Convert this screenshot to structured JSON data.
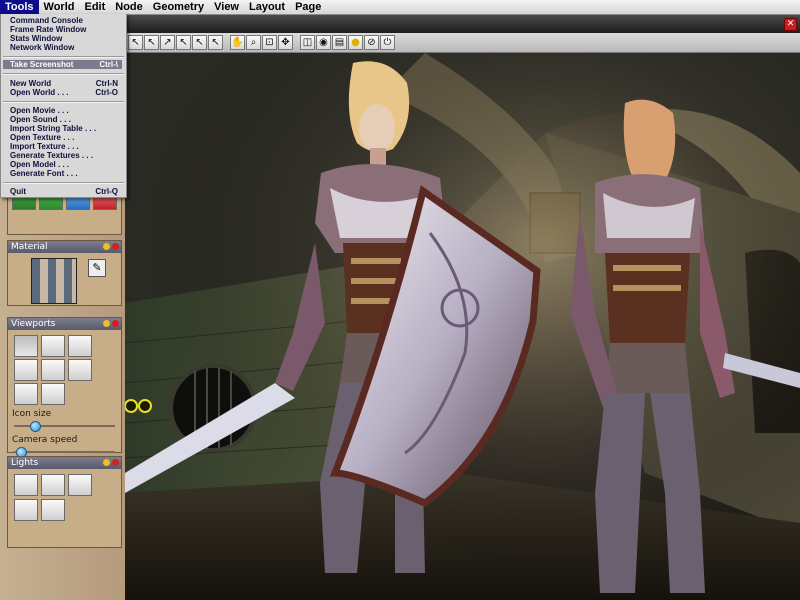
{
  "menubar": {
    "items": [
      {
        "label": "Tools"
      },
      {
        "label": "World"
      },
      {
        "label": "Edit"
      },
      {
        "label": "Node"
      },
      {
        "label": "Geometry"
      },
      {
        "label": "View"
      },
      {
        "label": "Layout"
      },
      {
        "label": "Page"
      }
    ]
  },
  "tools_menu": {
    "items": [
      {
        "label": "Command Console",
        "shortcut": ""
      },
      {
        "label": "Frame Rate Window",
        "shortcut": ""
      },
      {
        "label": "Stats Window",
        "shortcut": ""
      },
      {
        "label": "Network Window",
        "shortcut": ""
      },
      {
        "label": "Take Screenshot",
        "shortcut": "Ctrl-\\"
      },
      {
        "label": "New World",
        "shortcut": "Ctrl-N"
      },
      {
        "label": "Open World . . .",
        "shortcut": "Ctrl-O"
      },
      {
        "label": "Open Movie . . .",
        "shortcut": ""
      },
      {
        "label": "Open Sound . . .",
        "shortcut": ""
      },
      {
        "label": "Import String Table . . .",
        "shortcut": ""
      },
      {
        "label": "Open Texture . . .",
        "shortcut": ""
      },
      {
        "label": "Import Texture . . .",
        "shortcut": ""
      },
      {
        "label": "Generate Textures . . .",
        "shortcut": ""
      },
      {
        "label": "Open Model . . .",
        "shortcut": ""
      },
      {
        "label": "Generate Font . . .",
        "shortcut": ""
      },
      {
        "label": "Quit",
        "shortcut": "Ctrl-Q"
      }
    ],
    "highlighted": "Take Screenshot"
  },
  "panels": {
    "material": {
      "title": "Material"
    },
    "viewports": {
      "title": "Viewports",
      "icon_size_label": "Icon size",
      "icon_size_value": 0.18,
      "camera_speed_label": "Camera speed",
      "camera_speed_value": 0.02
    },
    "lights": {
      "title": "Lights"
    }
  },
  "colors": {
    "menu_highlight": "#0c0c8c",
    "panel_bg": "#c8ad89",
    "panel_header": "#6a6a7e",
    "close_button": "#c82020"
  }
}
